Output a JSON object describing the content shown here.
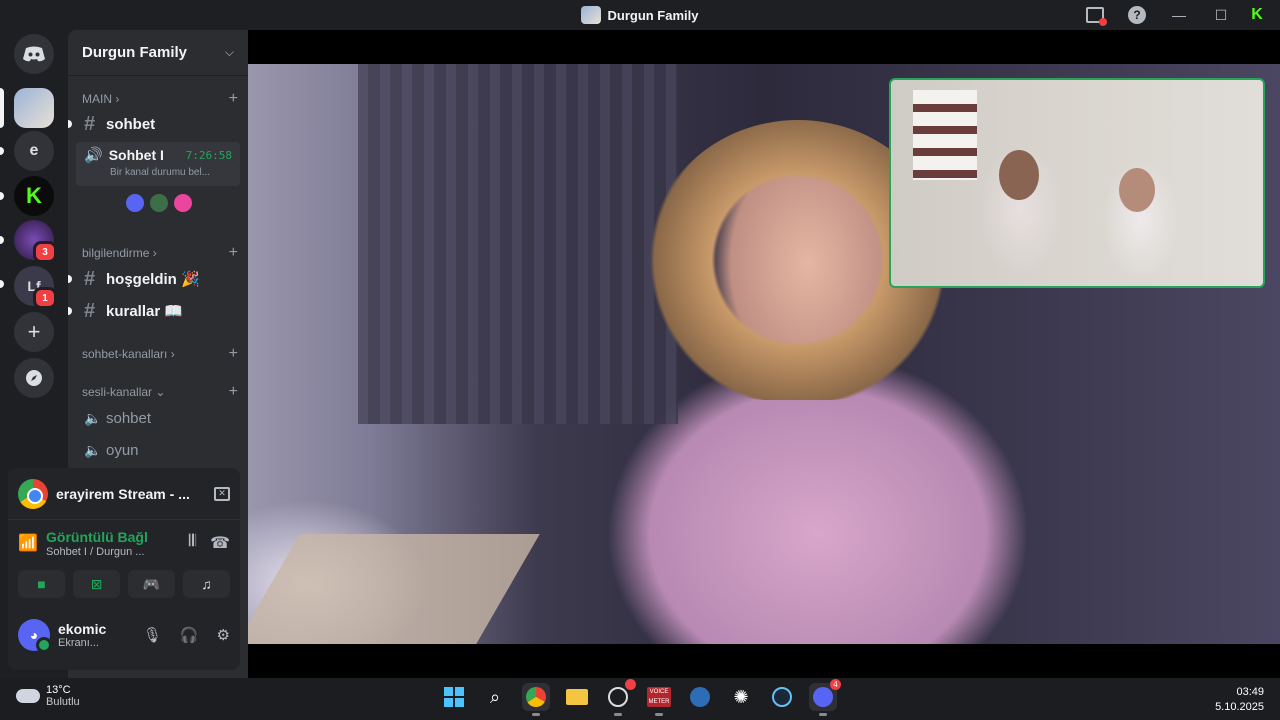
{
  "window": {
    "title": "Durgun Family"
  },
  "rail": {
    "servers": [
      {
        "name": "home",
        "label": ""
      },
      {
        "name": "durgun-family",
        "label": ""
      },
      {
        "name": "server-e",
        "label": "e"
      },
      {
        "name": "kick-server",
        "label": "K"
      },
      {
        "name": "server-wizard",
        "label": "",
        "badge": "3"
      },
      {
        "name": "server-lf",
        "label": "Lf",
        "badge": "1"
      }
    ],
    "add_label": "+"
  },
  "guild": {
    "name": "Durgun Family"
  },
  "categories": {
    "main": "MAIN",
    "bilgilendirme": "bilgilendirme",
    "sohbet_kanallari": "sohbet-kanalları",
    "sesli_kanallar": "sesli-kanallar"
  },
  "channels": {
    "sohbet": "sohbet",
    "voice_active": {
      "name": "Sohbet I",
      "timer": "7:26:58",
      "status": "Bir kanal durumu bel..."
    },
    "hosgeldin": "hoşgeldin 🎉",
    "kurallar": "kurallar 📖",
    "voice_sohbet": "sohbet",
    "voice_oyun": "oyun"
  },
  "panel": {
    "stream_title": "erayirem Stream - ...",
    "connection_status": "Görüntülü Bağl",
    "connection_channel": "Sohbet I / Durgun ...",
    "username": "ekomic",
    "user_status": "Ekranı..."
  },
  "taskbar": {
    "weather_temp": "13°C",
    "weather_desc": "Bulutlu",
    "time": "03:49",
    "date": "5.10.2025",
    "voicemeeter_label": "VOICE METER",
    "discord_badge": "4"
  },
  "colors": {
    "accent": "#5865f2",
    "online": "#23a55a",
    "danger": "#f23f43",
    "kick": "#53fc18"
  }
}
